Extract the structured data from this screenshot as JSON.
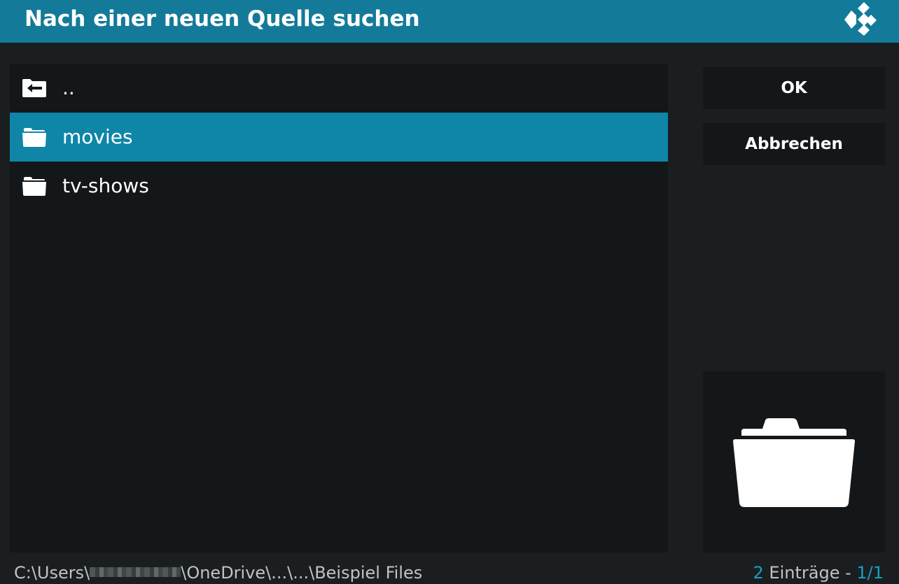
{
  "dialog": {
    "title": "Nach einer neuen Quelle suchen",
    "logo_icon": "kodi-logo"
  },
  "list": {
    "items": [
      {
        "label": "..",
        "icon": "back-folder-icon",
        "selected": false
      },
      {
        "label": "movies",
        "icon": "folder-icon",
        "selected": true
      },
      {
        "label": "tv-shows",
        "icon": "folder-icon",
        "selected": false
      }
    ]
  },
  "buttons": {
    "ok_label": "OK",
    "cancel_label": "Abbrechen"
  },
  "preview": {
    "icon": "folder-icon"
  },
  "footer": {
    "path_prefix": "C:\\Users\\",
    "path_suffix": "\\OneDrive\\...\\...\\Beispiel Files",
    "count": "2",
    "entries_label": " Einträge - ",
    "page": "1/1"
  },
  "colors": {
    "header": "#147a99",
    "selection": "#0f86a8",
    "accent": "#14a0c8",
    "panel": "#141719",
    "background": "#1b1e20"
  }
}
